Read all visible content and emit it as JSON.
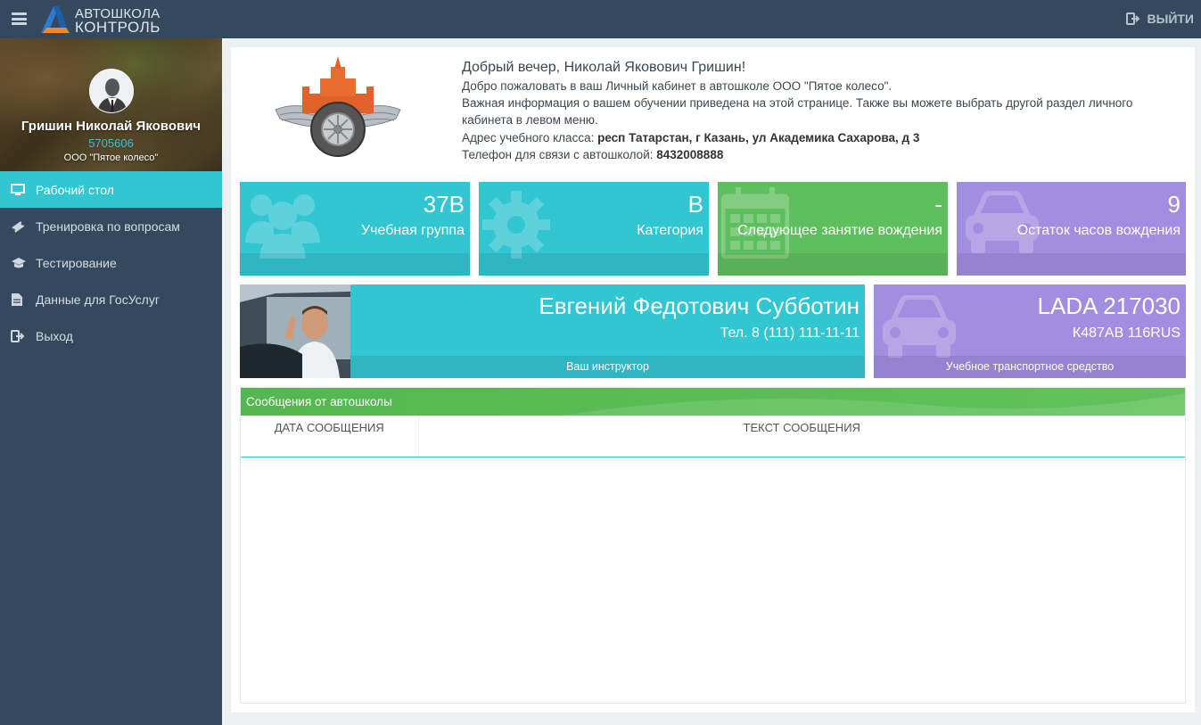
{
  "topbar": {
    "logo_line1": "АВТОШКОЛА",
    "logo_line2": "КОНТРОЛЬ",
    "logout_label": "ВЫЙТИ"
  },
  "profile": {
    "name": "Гришин Николай Яковович",
    "id": "5705606",
    "org": "ООО \"Пятое колесо\""
  },
  "menu": [
    {
      "label": "Рабочий стол",
      "icon": "monitor-icon",
      "active": true
    },
    {
      "label": "Тренировка по вопросам",
      "icon": "ticket-icon"
    },
    {
      "label": "Тестирование",
      "icon": "graduation-cap-icon"
    },
    {
      "label": "Данные для ГосУслуг",
      "icon": "document-icon"
    },
    {
      "label": "Выход",
      "icon": "sign-out-icon"
    }
  ],
  "welcome": {
    "hello": "Добрый вечер, Николай Яковович Гришин!",
    "line1": "Добро пожаловать в ваш Личный кабинет в автошколе ООО \"Пятое колесо\".",
    "line2": "Важная информация о вашем обучении приведена на этой странице. Также вы можете выбрать другой раздел личного кабинета в левом меню.",
    "address_label": "Адрес учебного класса:",
    "address_value": "респ Татарстан, г Казань, ул Академика Сахарова, д 3",
    "phone_label": "Телефон для связи с автошколой:",
    "phone_value": "8432008888"
  },
  "tiles": [
    {
      "value": "37В",
      "label": "Учебная группа",
      "color": "#32c5d2",
      "icon": "users-icon"
    },
    {
      "value": "В",
      "label": "Категория",
      "color": "#32c5d2",
      "icon": "gear-icon"
    },
    {
      "value": "-",
      "label": "Следующее занятие вождения",
      "color": "#5fbf5e",
      "icon": "calendar-icon"
    },
    {
      "value": "9",
      "label": "Остаток часов вождения",
      "color": "#a28de0",
      "icon": "car-icon"
    }
  ],
  "instructor": {
    "name": "Евгений Федотович Субботин",
    "phone": "Тел. 8 (111) 111-11-11",
    "caption": "Ваш инструктор"
  },
  "vehicle": {
    "model": "LADA 217030",
    "plate": "К487АВ 116RUS",
    "caption": "Учебное транспортное средство"
  },
  "messages": {
    "title": "Сообщения от автошколы",
    "col_date": "ДАТА СООБЩЕНИЯ",
    "col_text": "ТЕКСТ СООБЩЕНИЯ",
    "rows": []
  }
}
